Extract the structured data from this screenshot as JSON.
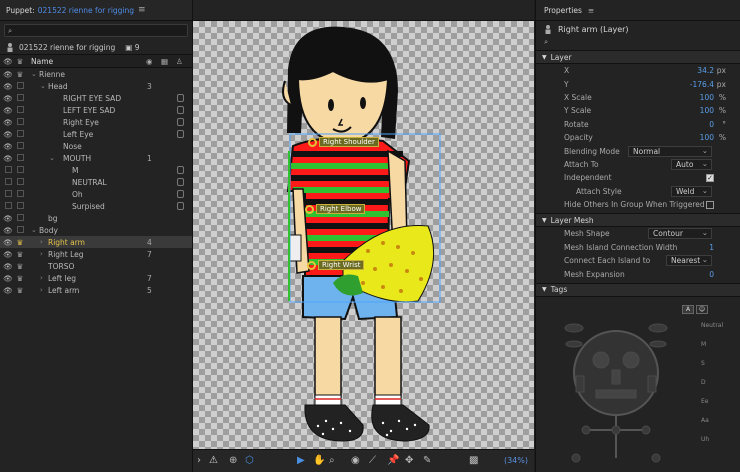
{
  "left_panel": {
    "title": "Puppet:",
    "file": "021522 rienne for rigging",
    "search_placeholder": "",
    "puppet_name": "021522 rienne for rigging",
    "puppet_count": "9",
    "col_name": "Name",
    "rows": [
      {
        "label": "Rienne",
        "num": ""
      },
      {
        "label": "Head",
        "num": "3"
      },
      {
        "label": "RIGHT EYE SAD",
        "num": ""
      },
      {
        "label": "LEFT EYE SAD",
        "num": ""
      },
      {
        "label": "Right Eye",
        "num": ""
      },
      {
        "label": "Left Eye",
        "num": ""
      },
      {
        "label": "Nose",
        "num": ""
      },
      {
        "label": "MOUTH",
        "num": "1"
      },
      {
        "label": "M",
        "num": ""
      },
      {
        "label": "NEUTRAL",
        "num": ""
      },
      {
        "label": "Oh",
        "num": ""
      },
      {
        "label": "Surpised",
        "num": ""
      },
      {
        "label": "bg",
        "num": ""
      },
      {
        "label": "Body",
        "num": ""
      },
      {
        "label": "Right arm",
        "num": "4"
      },
      {
        "label": "Right Leg",
        "num": "7"
      },
      {
        "label": "TORSO",
        "num": ""
      },
      {
        "label": "Left leg",
        "num": "7"
      },
      {
        "label": "Left arm",
        "num": "5"
      }
    ]
  },
  "stage": {
    "handles": {
      "shoulder": "Right Shoulder",
      "elbow": "Right Elbow",
      "wrist": "Right Wrist"
    },
    "zoom": "(34%)"
  },
  "right_panel": {
    "title": "Properties",
    "layer_name": "Right arm (Layer)",
    "section_layer": "Layer",
    "props": [
      {
        "label": "X",
        "value": "34.2",
        "unit": "px"
      },
      {
        "label": "Y",
        "value": "-176.4",
        "unit": "px"
      },
      {
        "label": "X Scale",
        "value": "100",
        "unit": "%"
      },
      {
        "label": "Y Scale",
        "value": "100",
        "unit": "%"
      },
      {
        "label": "Rotate",
        "value": "0",
        "unit": "°"
      },
      {
        "label": "Opacity",
        "value": "100",
        "unit": "%"
      }
    ],
    "blending_mode_label": "Blending Mode",
    "blending_mode": "Normal",
    "attach_to_label": "Attach To",
    "attach_to": "Auto",
    "independent_label": "Independent",
    "attach_style_label": "Attach Style",
    "attach_style": "Weld",
    "hide_others_label": "Hide Others In Group When Triggered",
    "section_mesh": "Layer Mesh",
    "mesh_shape_label": "Mesh Shape",
    "mesh_shape": "Contour",
    "mesh_island_label": "Mesh Island Connection Width",
    "mesh_island_value": "1",
    "connect_label": "Connect Each Island to",
    "connect_value": "Nearest",
    "mesh_expansion_label": "Mesh Expansion",
    "mesh_expansion_value": "0",
    "section_tags": "Tags",
    "tag_btn_a": "A",
    "tag_list": [
      "Neutral",
      "M",
      "S",
      "D",
      "Ee",
      "Aa",
      "Uh"
    ]
  }
}
